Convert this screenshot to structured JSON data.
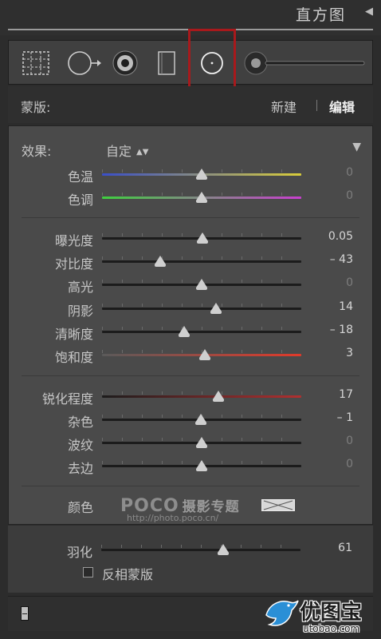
{
  "header": {
    "title": "直方图",
    "collapse_icon": "triangle-left-icon"
  },
  "toolbar": {
    "tools": [
      {
        "name": "crop-overlay-tool",
        "icon": "crop-grid-icon"
      },
      {
        "name": "spot-removal-tool",
        "icon": "circle-arrow-icon"
      },
      {
        "name": "red-eye-tool",
        "icon": "eye-icon"
      },
      {
        "name": "graduated-filter-tool",
        "icon": "rectangle-icon"
      },
      {
        "name": "radial-filter-tool",
        "icon": "circle-dot-icon",
        "selected": true
      },
      {
        "name": "adjustment-brush-tool",
        "icon": "brush-icon"
      }
    ],
    "highlight_color": "#a8191c"
  },
  "mask": {
    "label": "蒙版:",
    "new_label": "新建",
    "edit_label": "编辑"
  },
  "effect": {
    "label": "效果:",
    "value": "自定"
  },
  "sliders": [
    {
      "id": "temp",
      "label": "色温",
      "value": "0",
      "pos": 0.5,
      "dim": true,
      "gradient": [
        "#3a4fc8",
        "#d9cd3a"
      ]
    },
    {
      "id": "tint",
      "label": "色调",
      "value": "0",
      "pos": 0.5,
      "dim": true,
      "gradient": [
        "#3fcf3f",
        "#c93fcf"
      ]
    },
    {
      "id": "exposure",
      "label": "曝光度",
      "value": "0.05",
      "pos": 0.505,
      "dim": false,
      "gradient": null
    },
    {
      "id": "contrast",
      "label": "对比度",
      "value": "– 43",
      "pos": 0.29,
      "dim": false,
      "gradient": null
    },
    {
      "id": "highlights",
      "label": "高光",
      "value": "0",
      "pos": 0.5,
      "dim": true,
      "gradient": null
    },
    {
      "id": "shadows",
      "label": "阴影",
      "value": "14",
      "pos": 0.57,
      "dim": false,
      "gradient": null
    },
    {
      "id": "clarity",
      "label": "清晰度",
      "value": "– 18",
      "pos": 0.41,
      "dim": false,
      "gradient": null
    },
    {
      "id": "saturation",
      "label": "饱和度",
      "value": "3",
      "pos": 0.515,
      "dim": false,
      "gradient": [
        "#5a5a5a",
        "#e03a2a"
      ]
    },
    {
      "id": "sharpness",
      "label": "锐化程度",
      "value": "17",
      "pos": 0.585,
      "dim": false,
      "gradient": [
        "#1c1c1c",
        "#b03030"
      ]
    },
    {
      "id": "noise",
      "label": "杂色",
      "value": "– 1",
      "pos": 0.495,
      "dim": false,
      "gradient": null
    },
    {
      "id": "moire",
      "label": "波纹",
      "value": "0",
      "pos": 0.5,
      "dim": true,
      "gradient": null
    },
    {
      "id": "defringe",
      "label": "去边",
      "value": "0",
      "pos": 0.5,
      "dim": true,
      "gradient": null
    }
  ],
  "color": {
    "label": "颜色"
  },
  "watermark": {
    "logo": "POCO",
    "sub": "摄影专题",
    "url": "http://photo.poco.cn/"
  },
  "feather": {
    "label": "羽化",
    "value": "61",
    "pos": 0.61
  },
  "invert": {
    "label": "反相蒙版"
  },
  "brand": {
    "name": "优图宝",
    "domain": "utobao.com"
  }
}
